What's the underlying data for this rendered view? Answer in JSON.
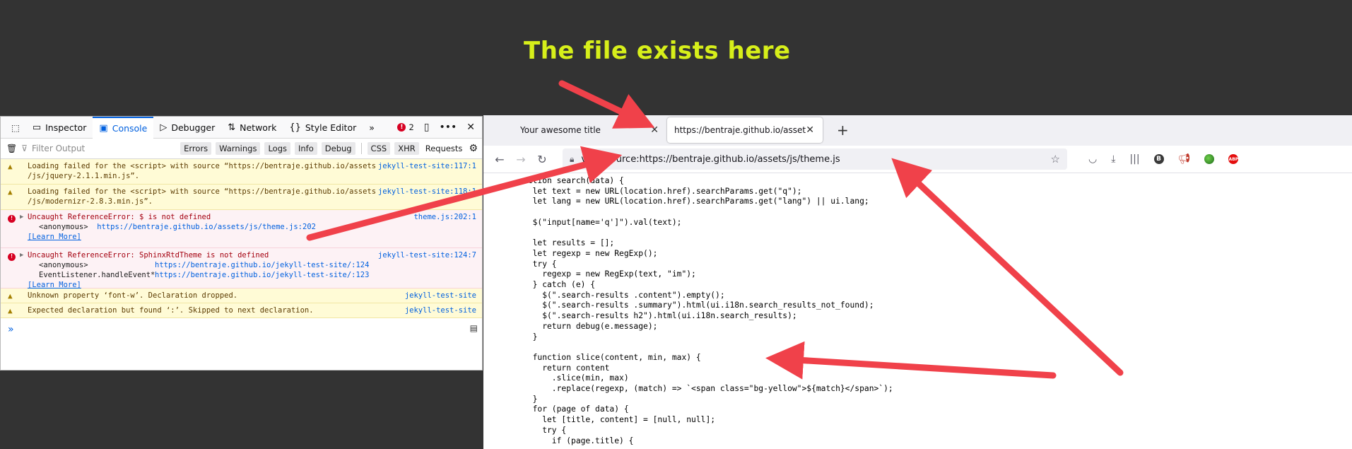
{
  "headline": "The file exists here",
  "devtools": {
    "tabs": [
      {
        "label": "Inspector",
        "icon": "inspector-icon"
      },
      {
        "label": "Console",
        "icon": "console-icon"
      },
      {
        "label": "Debugger",
        "icon": "debugger-icon"
      },
      {
        "label": "Network",
        "icon": "network-icon"
      },
      {
        "label": "Style Editor",
        "icon": "style-editor-icon"
      }
    ],
    "error_count": "2",
    "filter_placeholder": "Filter Output",
    "filter_chips": [
      "Errors",
      "Warnings",
      "Logs",
      "Info",
      "Debug"
    ],
    "filter_chips2": [
      "CSS",
      "XHR",
      "Requests"
    ],
    "messages": [
      {
        "type": "warn",
        "text1": "Loading failed for the <script> with source “https://bentraje.github.io/assets",
        "text2": "/js/jquery-2.1.1.min.js”.",
        "source": "jekyll-test-site:117:1"
      },
      {
        "type": "warn",
        "text1": "Loading failed for the <script> with source “https://bentraje.github.io/assets",
        "text2": "/js/modernizr-2.8.3.min.js”.",
        "source": "jekyll-test-site:118:1"
      },
      {
        "type": "err",
        "text1": "Uncaught ReferenceError: $ is not defined",
        "anon": "<anonymous>",
        "link": "https://bentraje.github.io/assets/js/theme.js:202",
        "learn": "[Learn More]",
        "source": "theme.js:202:1"
      },
      {
        "type": "err",
        "text1": "Uncaught ReferenceError: SphinxRtdTheme is not defined",
        "anon": "<anonymous>",
        "link": "https://bentraje.github.io/jekyll-test-site/:124",
        "anon2": "EventListener.handleEvent*",
        "link2": "https://bentraje.github.io/jekyll-test-site/:123",
        "learn": "[Learn More]",
        "source": "jekyll-test-site:124:7"
      },
      {
        "type": "warn",
        "text1": "Unknown property ‘font-w’.  Declaration dropped.",
        "source": "jekyll-test-site"
      },
      {
        "type": "warn",
        "text1": "Expected declaration but found ‘:’.  Skipped to next declaration.",
        "source": "jekyll-test-site"
      }
    ],
    "prompt": "»"
  },
  "browser": {
    "tabs": [
      {
        "title": "Your awesome title"
      },
      {
        "title": "https://bentraje.github.io/assets/js/"
      }
    ],
    "url": "view-source:https://bentraje.github.io/assets/js/theme.js",
    "code": "nction search(data) {\n  let text = new URL(location.href).searchParams.get(\"q\");\n  let lang = new URL(location.href).searchParams.get(\"lang\") || ui.lang;\n\n  $(\"input[name='q']\").val(text);\n\n  let results = [];\n  let regexp = new RegExp();\n  try {\n    regexp = new RegExp(text, \"im\");\n  } catch (e) {\n    $(\".search-results .content\").empty();\n    $(\".search-results .summary\").html(ui.i18n.search_results_not_found);\n    $(\".search-results h2\").html(ui.i18n.search_results);\n    return debug(e.message);\n  }\n\n  function slice(content, min, max) {\n    return content\n      .slice(min, max)\n      .replace(regexp, (match) => `<span class=\"bg-yellow\">${match}</span>`);\n  }\n  for (page of data) {\n    let [title, content] = [null, null];\n    try {\n      if (page.title) {"
  },
  "colors": {
    "headline": "#d7ef1a",
    "arrow": "#f0414a",
    "background": "#333333"
  }
}
